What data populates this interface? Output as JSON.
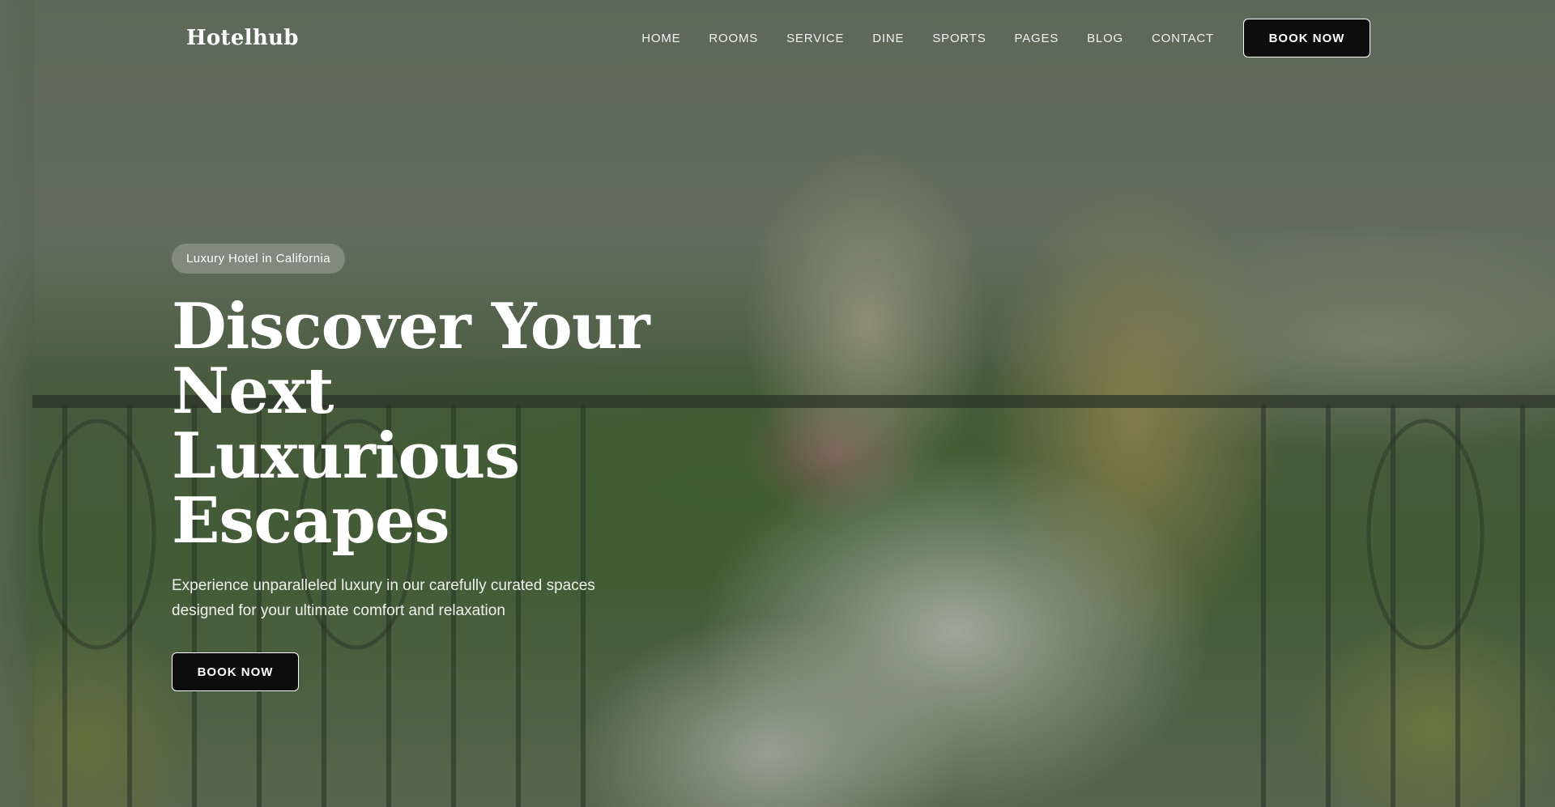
{
  "brand": {
    "name": "Hotelhub"
  },
  "nav": {
    "items": [
      {
        "label": "HOME"
      },
      {
        "label": "ROOMS"
      },
      {
        "label": "SERVICE"
      },
      {
        "label": "DINE"
      },
      {
        "label": "SPORTS"
      },
      {
        "label": "PAGES"
      },
      {
        "label": "BLOG"
      },
      {
        "label": "CONTACT"
      }
    ],
    "cta_label": "BOOK NOW"
  },
  "hero": {
    "badge": "Luxury Hotel in California",
    "title_line1": "Discover Your Next",
    "title_line2": "Luxurious Escapes",
    "subtitle_line1": "Experience unparalleled luxury in our carefully curated spaces",
    "subtitle_line2": "designed for your ultimate comfort and relaxation",
    "cta_label": "BOOK NOW"
  },
  "colors": {
    "button_bg": "#0d0d0d",
    "button_border": "#ffffff",
    "text": "#ffffff",
    "overlay": "#303e2e"
  }
}
